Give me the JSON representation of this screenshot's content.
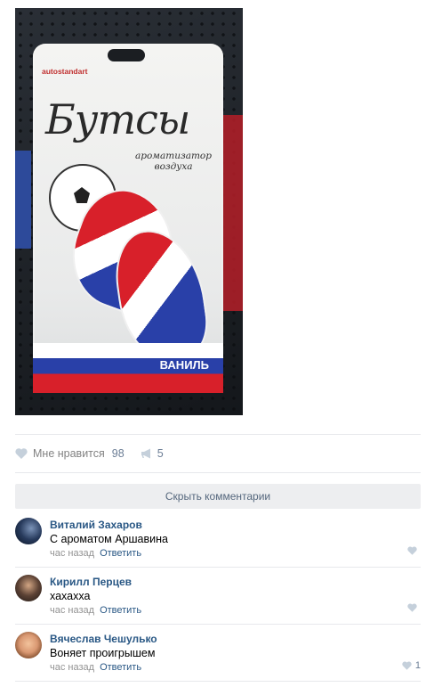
{
  "post": {
    "photo": {
      "brand": "autostandart",
      "product_title": "Бутсы",
      "product_subtitle": "ароматизатор воздуха",
      "flavor": "ВАНИЛЬ"
    },
    "likes": {
      "label": "Мне нравится",
      "count": "98"
    },
    "shares": {
      "count": "5"
    }
  },
  "comments_toggle": {
    "label": "Скрыть комментарии"
  },
  "comments": [
    {
      "author": "Виталий Захаров",
      "text": "С ароматом Аршавина",
      "time": "час назад",
      "reply": "Ответить",
      "likes": ""
    },
    {
      "author": "Кирилл Перцев",
      "text": "хахахха",
      "time": "час назад",
      "reply": "Ответить",
      "likes": ""
    },
    {
      "author": "Вячеслав Чешулько",
      "text": "Воняет проигрышем",
      "time": "час назад",
      "reply": "Ответить",
      "likes": "1"
    }
  ],
  "colors": {
    "link": "#2a5885",
    "meta": "#939393",
    "like_icon": "#c5d0db",
    "separator": "#e7e8ec"
  }
}
